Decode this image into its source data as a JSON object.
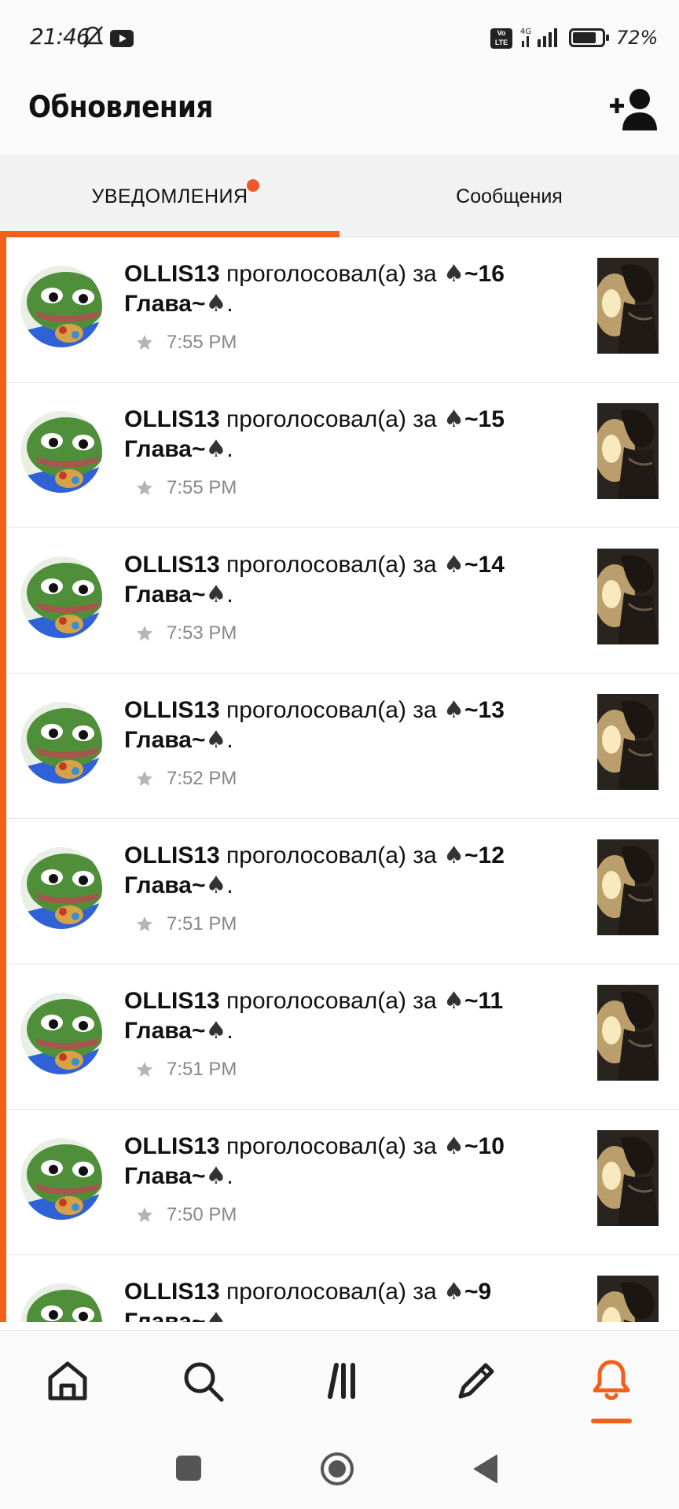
{
  "status_bar": {
    "time": "21:46",
    "network": "4G",
    "battery": "72%",
    "icons": [
      "bell-off-icon",
      "youtube-icon",
      "volte-icon",
      "signal-icon",
      "battery-icon"
    ]
  },
  "header": {
    "title": "Обновления",
    "add_user_icon": "add-user-icon"
  },
  "tabs": [
    {
      "label": "УВЕДОМЛЕНИЯ",
      "active": true,
      "has_badge": true
    },
    {
      "label": "Сообщения",
      "active": false,
      "has_badge": false
    }
  ],
  "colors": {
    "accent": "#f2601a",
    "badge": "#f0582a"
  },
  "notifications": [
    {
      "user": "OLLIS13",
      "action": " проголосовал(а) за ",
      "spade": "♠",
      "item": "~16 Глава~",
      "suffix": ".",
      "time": "7:55 PM"
    },
    {
      "user": "OLLIS13",
      "action": " проголосовал(а) за ",
      "spade": "♠",
      "item": "~15 Глава~",
      "suffix": ".",
      "time": "7:55 PM"
    },
    {
      "user": "OLLIS13",
      "action": " проголосовал(а) за ",
      "spade": "♠",
      "item": "~14 Глава~",
      "suffix": ".",
      "time": "7:53 PM"
    },
    {
      "user": "OLLIS13",
      "action": " проголосовал(а) за ",
      "spade": "♠",
      "item": "~13 Глава~",
      "suffix": ".",
      "time": "7:52 PM"
    },
    {
      "user": "OLLIS13",
      "action": " проголосовал(а) за ",
      "spade": "♠",
      "item": "~12 Глава~",
      "suffix": ".",
      "time": "7:51 PM"
    },
    {
      "user": "OLLIS13",
      "action": " проголосовал(а) за ",
      "spade": "♠",
      "item": "~11 Глава~",
      "suffix": ".",
      "time": "7:51 PM"
    },
    {
      "user": "OLLIS13",
      "action": " проголосовал(а) за ",
      "spade": "♠",
      "item": "~10 Глава~",
      "suffix": ".",
      "time": "7:50 PM"
    },
    {
      "user": "OLLIS13",
      "action": " проголосовал(а) за ",
      "spade": "♠",
      "item": "~9 Глава~",
      "suffix": ".",
      "time": ""
    }
  ],
  "bottom_nav": [
    {
      "name": "home-icon",
      "active": false
    },
    {
      "name": "search-icon",
      "active": false
    },
    {
      "name": "library-icon",
      "active": false
    },
    {
      "name": "pencil-icon",
      "active": false
    },
    {
      "name": "bell-icon",
      "active": true
    }
  ],
  "system_nav": [
    "recent-apps-icon",
    "home-circle-icon",
    "back-icon"
  ]
}
